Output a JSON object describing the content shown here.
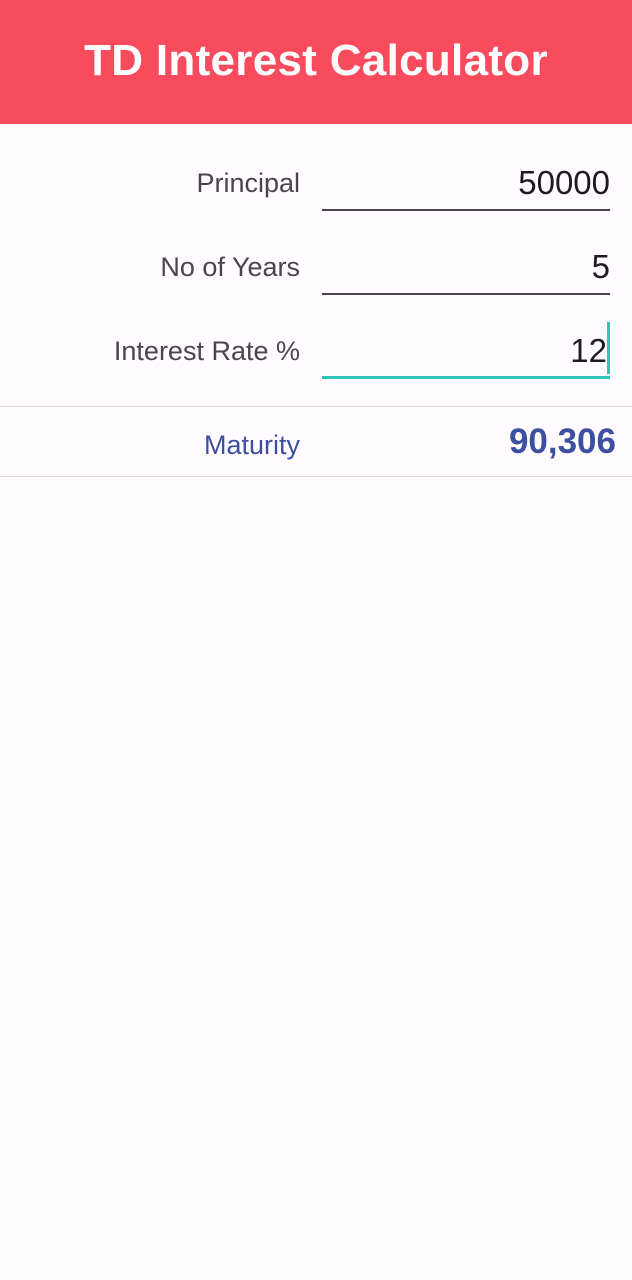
{
  "header": {
    "title": "TD Interest Calculator"
  },
  "form": {
    "principal": {
      "label": "Principal",
      "value": "50000"
    },
    "years": {
      "label": "No of Years",
      "value": "5"
    },
    "rate": {
      "label": "Interest Rate %",
      "value": "12"
    }
  },
  "result": {
    "label": "Maturity",
    "value": "90,306"
  },
  "colors": {
    "header_bg": "#f94b5e",
    "accent_focus": "#2ec4b6",
    "result_text": "#3d4fa1"
  }
}
